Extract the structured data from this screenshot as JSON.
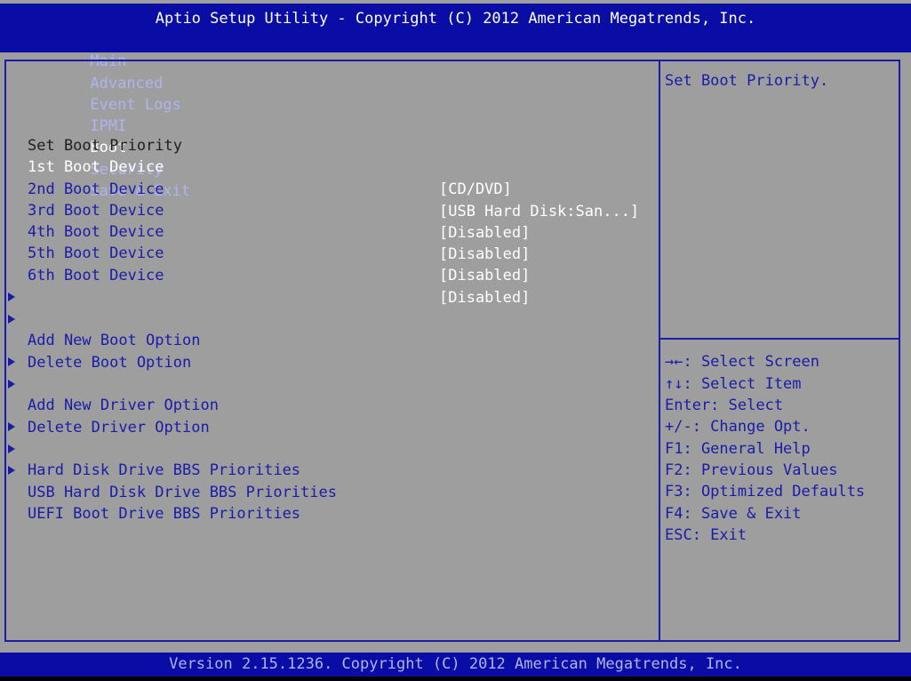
{
  "header": {
    "title": "Aptio Setup Utility - Copyright (C) 2012 American Megatrends, Inc.",
    "menu": [
      "Main",
      "Advanced",
      "Event Logs",
      "IPMI",
      "Boot",
      "Security",
      "Save & Exit"
    ],
    "active_menu": "Boot"
  },
  "boot": {
    "section_title": "Set Boot Priority",
    "devices": [
      {
        "label": "1st Boot Device",
        "value": "[CD/DVD]"
      },
      {
        "label": "2nd Boot Device",
        "value": "[USB Hard Disk:San...]"
      },
      {
        "label": "3rd Boot Device",
        "value": "[Disabled]"
      },
      {
        "label": "4th Boot Device",
        "value": "[Disabled]"
      },
      {
        "label": "5th Boot Device",
        "value": "[Disabled]"
      },
      {
        "label": "6th Boot Device",
        "value": "[Disabled]"
      }
    ],
    "submenus": [
      "Add New Boot Option",
      "Delete Boot Option",
      "Add New Driver Option",
      "Delete Driver Option",
      "Hard Disk Drive BBS Priorities",
      "USB Hard Disk Drive BBS Priorities",
      "UEFI Boot Drive BBS Priorities"
    ]
  },
  "help": {
    "description": "Set Boot Priority.",
    "keys": [
      "→←: Select Screen",
      "↑↓: Select Item",
      "Enter: Select",
      "+/-: Change Opt.",
      "F1: General Help",
      "F2: Previous Values",
      "F3: Optimized Defaults",
      "F4: Save & Exit",
      "ESC: Exit"
    ]
  },
  "footer": {
    "text": "Version 2.15.1236. Copyright (C) 2012 American Megatrends, Inc."
  },
  "colors": {
    "header_bg": "#0a0ca6",
    "panel_bg": "#9e9e9e",
    "accent_blue": "#1a1ca8",
    "highlight": "#ffffff"
  }
}
